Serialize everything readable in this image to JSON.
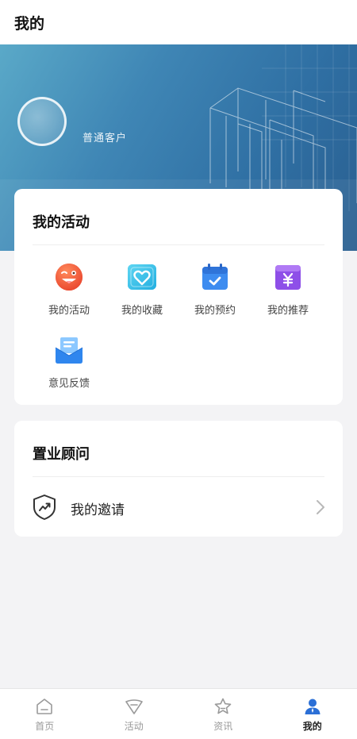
{
  "header": {
    "title": "我的"
  },
  "banner": {
    "user_type": "普通客户"
  },
  "activities": {
    "title": "我的活动",
    "items": [
      {
        "label": "我的活动",
        "icon": "emoji-face-icon"
      },
      {
        "label": "我的收藏",
        "icon": "heart-icon"
      },
      {
        "label": "我的预约",
        "icon": "calendar-check-icon"
      },
      {
        "label": "我的推荐",
        "icon": "yuan-bag-icon"
      },
      {
        "label": "意见反馈",
        "icon": "feedback-mail-icon"
      }
    ]
  },
  "advisor": {
    "title": "置业顾问",
    "invite_label": "我的邀请"
  },
  "tabbar": {
    "tabs": [
      {
        "label": "首页",
        "icon": "home-icon"
      },
      {
        "label": "活动",
        "icon": "activity-icon"
      },
      {
        "label": "资讯",
        "icon": "star-icon"
      },
      {
        "label": "我的",
        "icon": "user-icon",
        "active": true
      }
    ]
  },
  "colors": {
    "accent": "#2b6fd6",
    "banner": "#3f86b5"
  }
}
